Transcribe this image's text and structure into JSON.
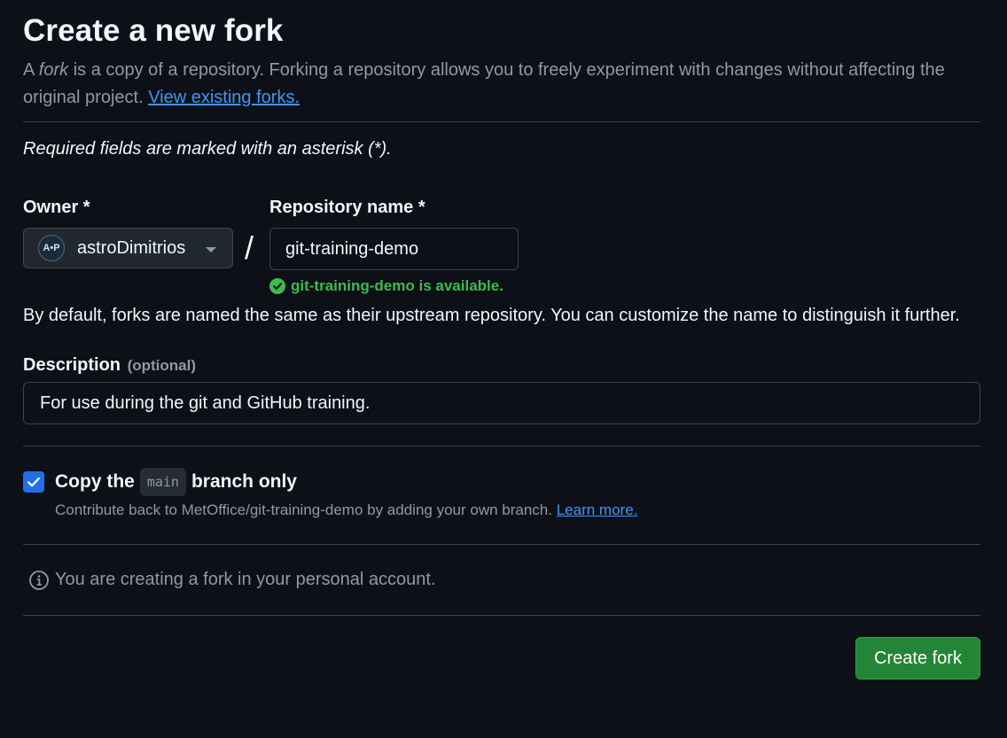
{
  "header": {
    "title": "Create a new fork",
    "intro_prefix": "A ",
    "intro_em": "fork",
    "intro_rest": " is a copy of a repository. Forking a repository allows you to freely experiment with changes without affecting the original project.",
    "intro_link": "View existing forks."
  },
  "required_note": "Required fields are marked with an asterisk (*).",
  "owner": {
    "label": "Owner *",
    "avatar_text": "A•P",
    "value": "astroDimitrios"
  },
  "separator": "/",
  "repository": {
    "label": "Repository name *",
    "value": "git-training-demo",
    "availability": "git-training-demo is available.",
    "status_color": "#3fb950"
  },
  "naming_hint": "By default, forks are named the same as their upstream repository. You can customize the name to distinguish it further.",
  "description": {
    "label": "Description",
    "optional": "(optional)",
    "value": "For use during the git and GitHub training."
  },
  "copy_branch": {
    "checked": true,
    "title_prefix": "Copy the",
    "branch": "main",
    "title_suffix": "branch only",
    "subtitle": "Contribute back to MetOffice/git-training-demo by adding your own branch.",
    "learn_more": "Learn more."
  },
  "info": {
    "icon": "info-icon",
    "text": "You are creating a fork in your personal account."
  },
  "actions": {
    "create_label": "Create fork",
    "create_color": "#238636"
  },
  "theme": {
    "background": "#0d1117",
    "link": "#4493f8",
    "accent": "#1f6feb"
  }
}
